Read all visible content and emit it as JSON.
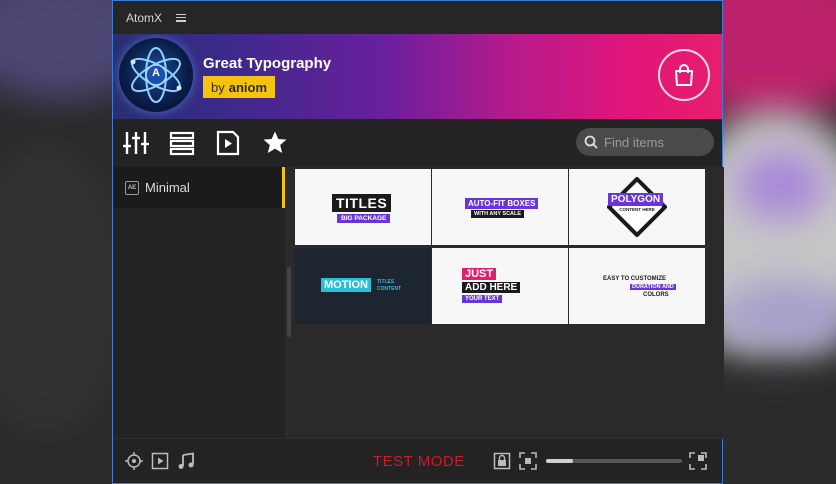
{
  "window": {
    "title": "AtomX"
  },
  "banner": {
    "title": "Great Typography",
    "author_prefix": "by",
    "author_name": "aniom",
    "logo_letter": "A"
  },
  "toolbar": {
    "icons": [
      "sliders-icon",
      "list-view-icon",
      "preview-play-icon",
      "favorites-star-icon"
    ],
    "search_placeholder": "Find items"
  },
  "sidebar": {
    "items": [
      {
        "icon_text": "AE",
        "label": "Minimal",
        "selected": true
      }
    ]
  },
  "grid": {
    "items": [
      {
        "line1": "TITLES",
        "line2": "BIG PACKAGE"
      },
      {
        "line1": "AUTO-FIT BOXES",
        "line2": "WITH ANY SCALE"
      },
      {
        "line1": "POLYGON",
        "line2": "CONTENT HERE"
      },
      {
        "line1": "MOTION",
        "line2": "TITLES",
        "line3": "CONTENT"
      },
      {
        "line1": "JUST",
        "line2": "ADD HERE",
        "line3": "YOUR TEXT"
      },
      {
        "line1": "EASY TO CUSTOMIZE",
        "line2": "DURATION AND",
        "line3": "COLORS"
      }
    ]
  },
  "footer": {
    "status_text": "TEST MODE",
    "zoom_level": 0.2
  },
  "colors": {
    "accent": "#f5c20f",
    "test_mode": "#c81e2a",
    "border": "#3d7dd8",
    "purple": "#6a35d8",
    "cyan": "#2bbfd6",
    "pink": "#e0206e"
  }
}
